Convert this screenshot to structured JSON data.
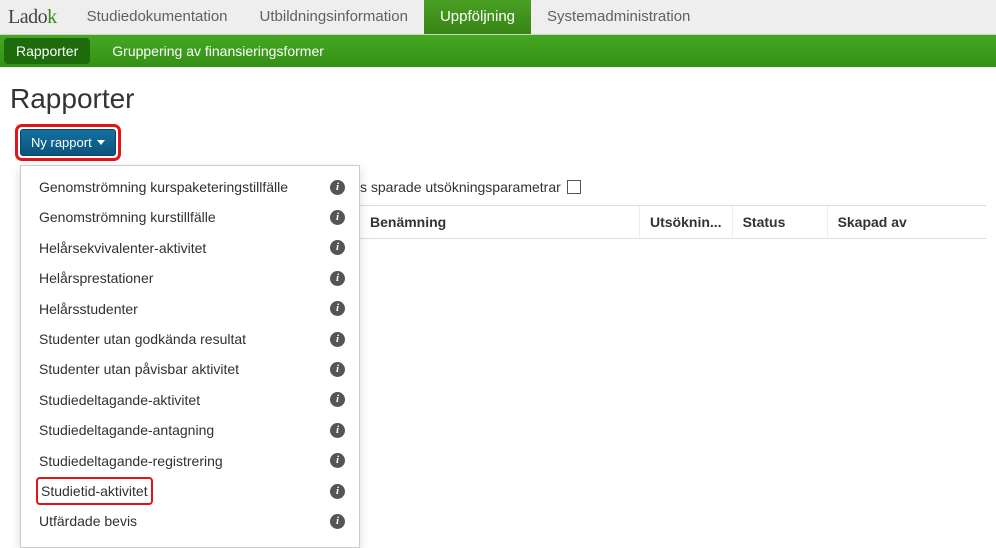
{
  "logo": {
    "text_prefix": "Lado",
    "text_suffix": "k"
  },
  "topnav": {
    "items": [
      {
        "label": "Studiedokumentation",
        "active": false
      },
      {
        "label": "Utbildningsinformation",
        "active": false
      },
      {
        "label": "Uppföljning",
        "active": true
      },
      {
        "label": "Systemadministration",
        "active": false
      }
    ]
  },
  "subnav": {
    "items": [
      {
        "label": "Rapporter",
        "active": true
      },
      {
        "label": "Gruppering av finansieringsformer",
        "active": false
      }
    ]
  },
  "page_title": "Rapporter",
  "new_report_button": "Ny rapport",
  "dropdown": {
    "items": [
      {
        "label": "Genomströmning kurspaketeringstillfälle"
      },
      {
        "label": "Genomströmning kurstillfälle"
      },
      {
        "label": "Helårsekvivalenter-aktivitet"
      },
      {
        "label": "Helårsprestationer"
      },
      {
        "label": "Helårsstudenter"
      },
      {
        "label": "Studenter utan godkända resultat"
      },
      {
        "label": "Studenter utan påvisbar aktivitet"
      },
      {
        "label": "Studiedeltagande-aktivitet"
      },
      {
        "label": "Studiedeltagande-antagning"
      },
      {
        "label": "Studiedeltagande-registrering"
      },
      {
        "label": "Studietid-aktivitet",
        "highlight": true
      },
      {
        "label": "Utfärdade bevis"
      }
    ]
  },
  "info_glyph": "i",
  "filter_label_suffix": "s sparade utsökningsparametrar",
  "table": {
    "headers": {
      "benamning": "Benämning",
      "utsokning": "Utsöknin...",
      "status": "Status",
      "skapad_av": "Skapad av"
    }
  }
}
